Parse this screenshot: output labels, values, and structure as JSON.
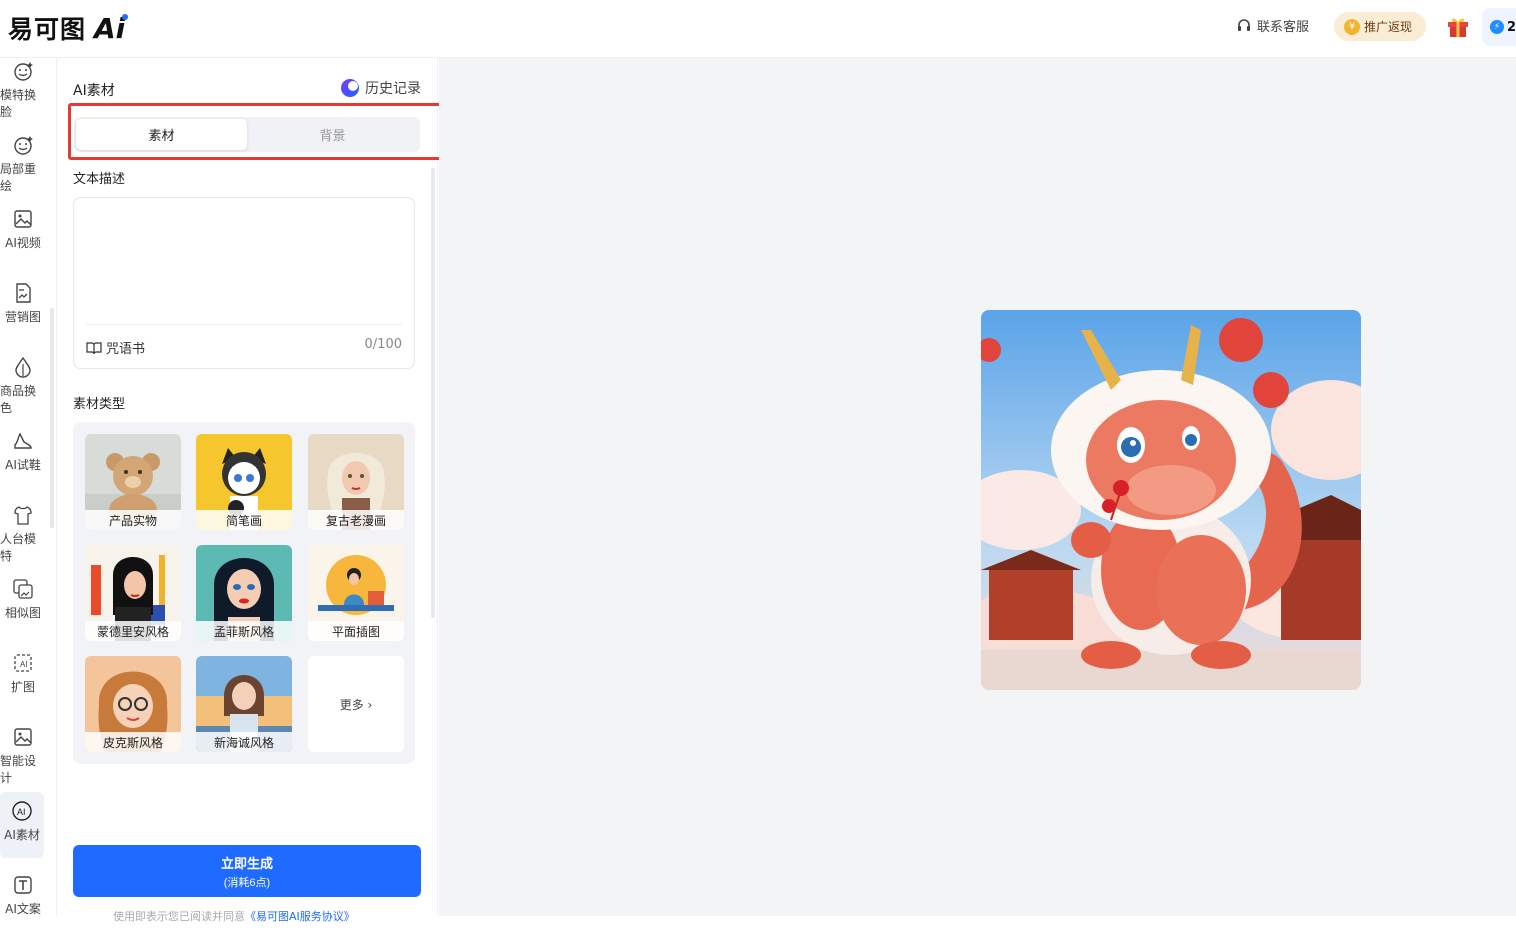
{
  "header": {
    "logo_text": "易可图",
    "logo_ai": "Ai",
    "support_label": "联系客服",
    "promo_label": "推广返现",
    "points_value": "2"
  },
  "rail": {
    "items": [
      {
        "label": "模特换脸",
        "icon": "smile-sparkle-icon"
      },
      {
        "label": "局部重绘",
        "icon": "smile-sparkle-icon"
      },
      {
        "label": "AI视频",
        "icon": "image-frame-icon"
      },
      {
        "label": "营销图",
        "icon": "document-image-icon"
      },
      {
        "label": "商品换色",
        "icon": "color-drop-icon"
      },
      {
        "label": "AI试鞋",
        "icon": "high-heel-icon"
      },
      {
        "label": "人台模特",
        "icon": "mannequin-icon"
      },
      {
        "label": "相似图",
        "icon": "similar-image-icon"
      },
      {
        "label": "扩图",
        "icon": "expand-ai-icon"
      },
      {
        "label": "智能设计",
        "icon": "smart-design-icon"
      },
      {
        "label": "AI素材",
        "icon": "ai-circle-icon"
      },
      {
        "label": "AI文案",
        "icon": "text-t-icon"
      }
    ],
    "active_index": 10
  },
  "panel": {
    "title": "AI素材",
    "history_label": "历史记录",
    "tabs": [
      {
        "label": "素材",
        "active": true
      },
      {
        "label": "背景",
        "active": false
      }
    ],
    "text_desc_label": "文本描述",
    "textarea": {
      "value": "",
      "placeholder": ""
    },
    "spellbook_label": "咒语书",
    "char_counter": "0/100",
    "material_type_label": "素材类型",
    "styles": [
      {
        "label": "产品实物"
      },
      {
        "label": "简笔画"
      },
      {
        "label": "复古老漫画"
      },
      {
        "label": "蒙德里安风格"
      },
      {
        "label": "孟菲斯风格"
      },
      {
        "label": "平面插图"
      },
      {
        "label": "皮克斯风格"
      },
      {
        "label": "新海诚风格"
      }
    ],
    "more_label": "更多 ›",
    "generate_line1": "立即生成",
    "generate_line2": "(消耗6点)",
    "terms_prefix": "使用即表示您已阅读并同意",
    "terms_link": "《易可图AI服务协议》"
  },
  "colors": {
    "primary": "#1f6bff",
    "highlight_border": "#e53935",
    "promo_bg": "#fbecd5"
  }
}
